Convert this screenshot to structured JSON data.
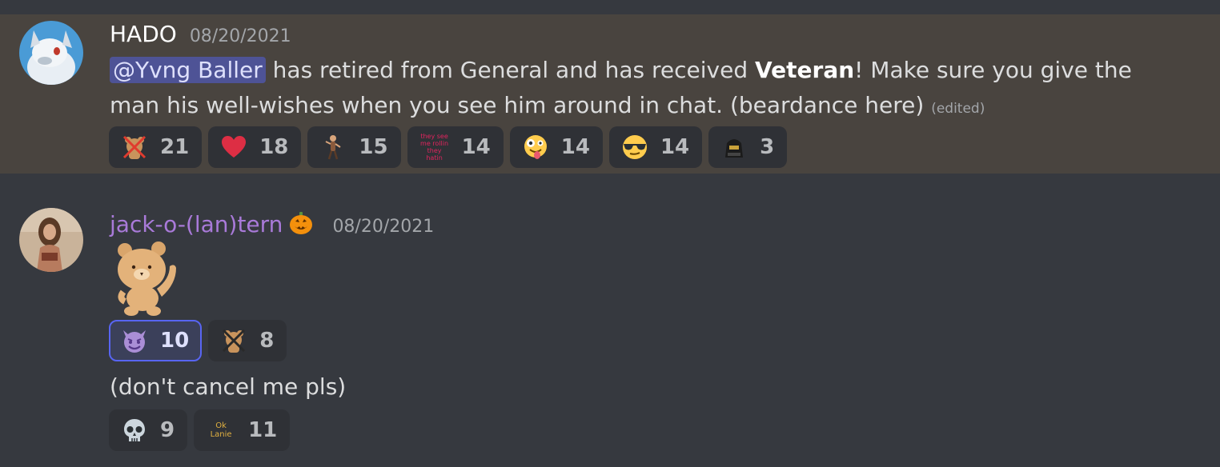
{
  "messages": [
    {
      "username": "HADO",
      "timestamp": "08/20/2021",
      "mention": "@Yvng Baller",
      "text_before_bold": " has retired from General and has received ",
      "bold": "Veteran",
      "text_after_bold": "! Make sure you give the man his well-wishes when you see him around in chat. (beardance here) ",
      "edited": "(edited)",
      "reactions": [
        {
          "emoji": "crossed-out-bear-emoji",
          "count": "21"
        },
        {
          "emoji": "red-heart-emoji",
          "count": "18"
        },
        {
          "emoji": "dancing-figure-emoji",
          "count": "15"
        },
        {
          "emoji": "text-image-emoji",
          "emoji_text": "they see me rollin they hatin",
          "count": "14"
        },
        {
          "emoji": "zany-face-emoji",
          "count": "14"
        },
        {
          "emoji": "sunglasses-face-emoji",
          "count": "14"
        },
        {
          "emoji": "dark-character-emoji",
          "count": "3"
        }
      ]
    },
    {
      "username": "jack-o-(lan)tern",
      "username_color": "#a97ad9",
      "timestamp": "08/20/2021",
      "sticker": "waving-bear-sticker",
      "sticker_reactions": [
        {
          "emoji": "smiling-imp-emoji",
          "count": "10",
          "active": true
        },
        {
          "emoji": "crossed-out-bear-emoji",
          "count": "8"
        }
      ],
      "text": "(don't cancel me pls)",
      "text_reactions": [
        {
          "emoji": "skull-emoji",
          "count": "9"
        },
        {
          "emoji": "ok-lanie-emoji",
          "emoji_text": "Ok Lanie",
          "count": "11"
        }
      ]
    }
  ],
  "colors": {
    "background": "#36393f",
    "highlight_background": "#49443f",
    "mention_background": "#4e5396",
    "active_reaction_border": "#5865f2"
  }
}
